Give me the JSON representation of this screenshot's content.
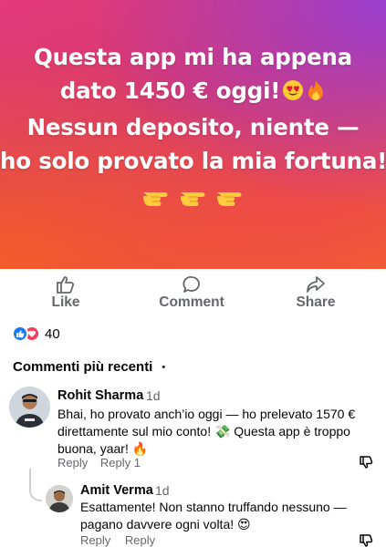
{
  "post": {
    "banner_lines": [
      "Questa app mi ha appena",
      "dato 1450 € oggi!",
      "Nessun deposito, niente —",
      "ho solo provato la mia fortuna!"
    ],
    "banner_emojis_line2": [
      "heart-eyes-emoji",
      "fire-emoji"
    ],
    "banner_bottom_emojis": [
      "pointing-hand-emoji",
      "pointing-hand-emoji",
      "pointing-hand-emoji"
    ],
    "banner_colors": {
      "top": "#e33a7a",
      "corner_purple": "#9b3fd0",
      "bottom_orange": "#f25c2a"
    }
  },
  "actions": {
    "like": "Like",
    "comment": "Comment",
    "share": "Share"
  },
  "reactions": {
    "types": [
      "like",
      "love"
    ],
    "count": "40"
  },
  "comments_sort": {
    "label": "Commenti più recenti"
  },
  "comments": [
    {
      "author": "Rohit Sharma",
      "age": "1d",
      "text": "Bhai, ho provato anch’io oggi — ho prelevato 1570 € direttamente sul mio conto! 💸 Questa app è troppo buona, yaar! 🔥",
      "reply_label": "Reply",
      "reply_count_label": "Reply 1"
    },
    {
      "author": "Amit Verma",
      "age": "1d",
      "text": "Esattamente! Non stanno truffando nessuno — pagano davvere ogni volta! 😍",
      "reply_label": "Reply",
      "reply_label_2": "Reply"
    }
  ],
  "colors": {
    "meta_gray": "#65676b",
    "like_blue": "#1877f2",
    "love_red": "#f33e58"
  }
}
